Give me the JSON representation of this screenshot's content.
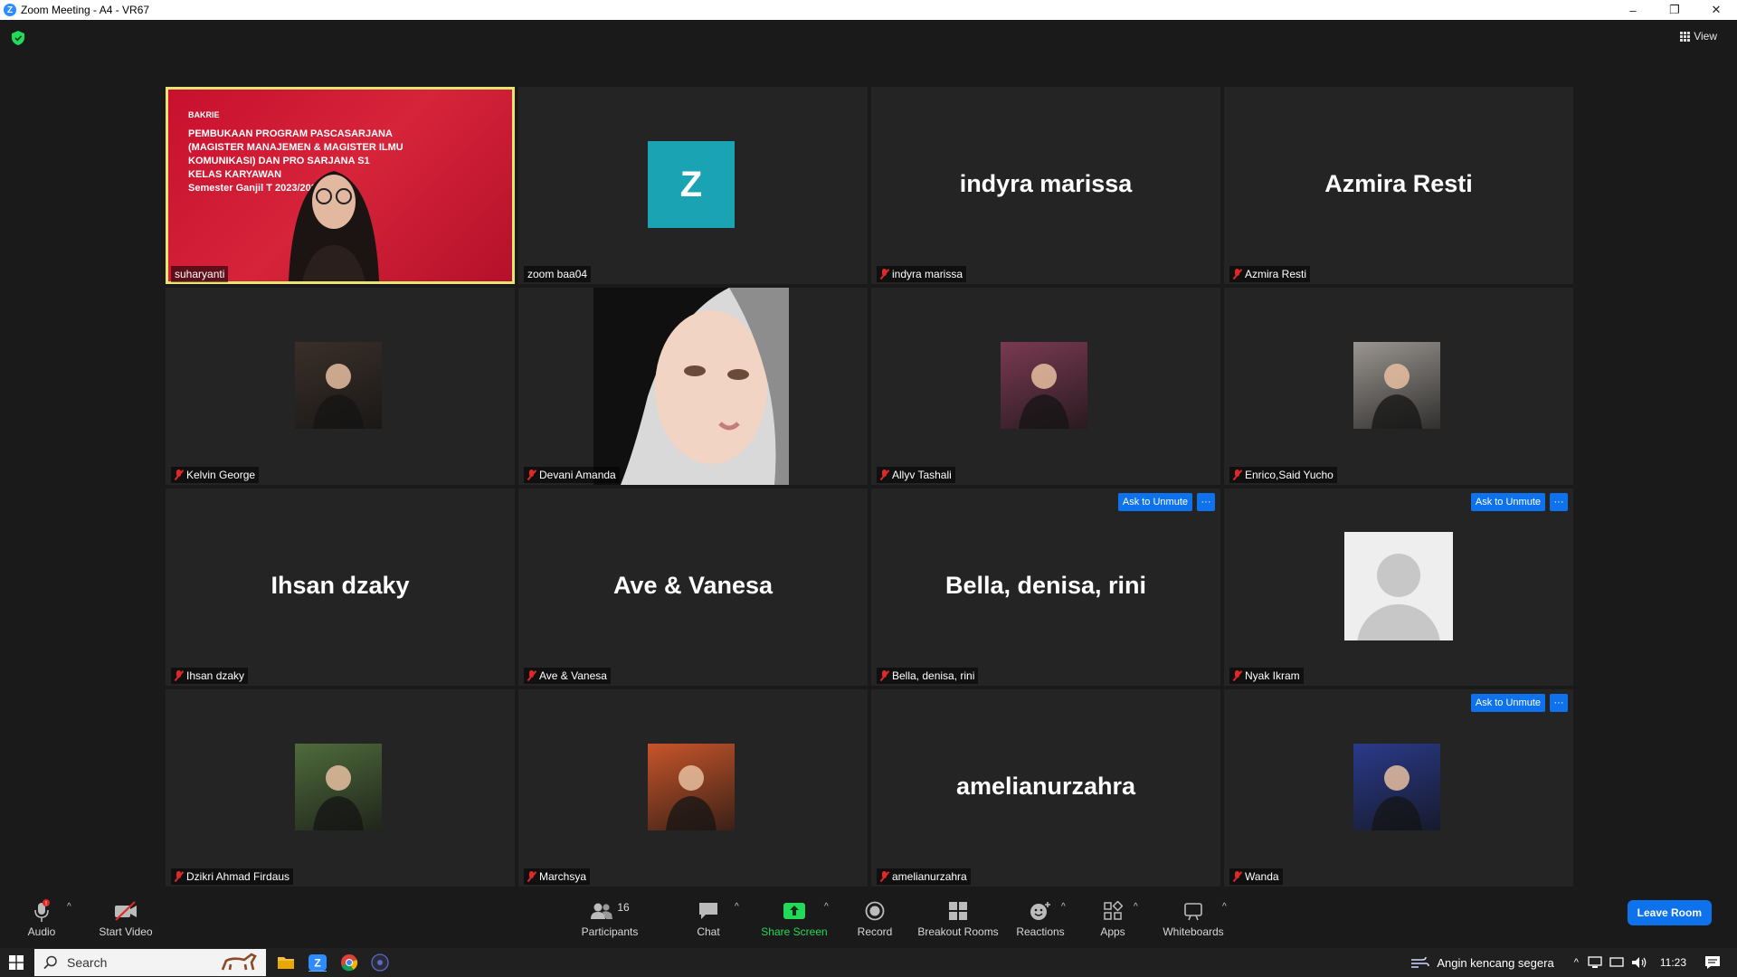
{
  "window": {
    "title": "Zoom Meeting - A4 - VR67",
    "minimize": "–",
    "restore": "❐",
    "close": "✕"
  },
  "top": {
    "view_label": "View"
  },
  "slide": {
    "logo": "BAKRIE",
    "lines": [
      "PEMBUKAAN PROGRAM PASCASARJANA",
      "(MAGISTER MANAJEMEN & MAGISTER ILMU",
      "KOMUNIKASI) DAN PRO      SARJANA S1",
      "KELAS KARYAWAN",
      "Semester Ganjil T          2023/2024"
    ]
  },
  "tiles": [
    {
      "label": "suharyanti",
      "type": "slide",
      "muted": false,
      "active": true
    },
    {
      "label": "zoom baa04",
      "type": "letter",
      "letter": "Z",
      "muted": false
    },
    {
      "label": "indyra marissa",
      "type": "name",
      "display": "indyra marissa",
      "muted": true
    },
    {
      "label": "Azmira Resti",
      "type": "name",
      "display": "Azmira Resti",
      "muted": true
    },
    {
      "label": "Kelvin George",
      "type": "photo",
      "photo": "#3a2f29",
      "muted": true
    },
    {
      "label": "Devani Amanda",
      "type": "video",
      "muted": true
    },
    {
      "label": "Allyv Tashali",
      "type": "photo",
      "photo": "#7a3a52",
      "muted": true
    },
    {
      "label": "Enrico,Said Yucho",
      "type": "photo",
      "photo": "#9a9590",
      "muted": true
    },
    {
      "label": "Ihsan dzaky",
      "type": "name",
      "display": "Ihsan dzaky",
      "muted": true
    },
    {
      "label": "Ave & Vanesa",
      "type": "name",
      "display": "Ave & Vanesa",
      "muted": true
    },
    {
      "label": "Bella, denisa, rini",
      "type": "name",
      "display": "Bella, denisa, rini",
      "muted": true,
      "ask": true
    },
    {
      "label": "Nyak Ikram",
      "type": "default",
      "muted": true,
      "ask": true
    },
    {
      "label": "Dzikri Ahmad Firdaus",
      "type": "photo",
      "photo": "#4f6b3c",
      "muted": true
    },
    {
      "label": "Marchsya",
      "type": "photo",
      "photo": "#c7552a",
      "muted": true
    },
    {
      "label": "amelianurzahra",
      "type": "name",
      "display": "amelianurzahra",
      "muted": true
    },
    {
      "label": "Wanda",
      "type": "photo",
      "photo": "#2a3a8a",
      "muted": true,
      "ask": true
    }
  ],
  "ask_to_unmute_label": "Ask to Unmute",
  "more_label": "···",
  "toolbar": {
    "audio": "Audio",
    "start_video": "Start Video",
    "participants": "Participants",
    "participants_count": "16",
    "chat": "Chat",
    "share_screen": "Share Screen",
    "record": "Record",
    "breakout_rooms": "Breakout Rooms",
    "reactions": "Reactions",
    "apps": "Apps",
    "whiteboards": "Whiteboards",
    "leave_room": "Leave Room"
  },
  "taskbar": {
    "search": "Search",
    "weather": "Angin kencang segera",
    "time": "11:23"
  },
  "colors": {
    "accent": "#0e72ed",
    "share_green": "#23d959",
    "muted_red": "#e02828",
    "active_outline": "#e8e473"
  }
}
